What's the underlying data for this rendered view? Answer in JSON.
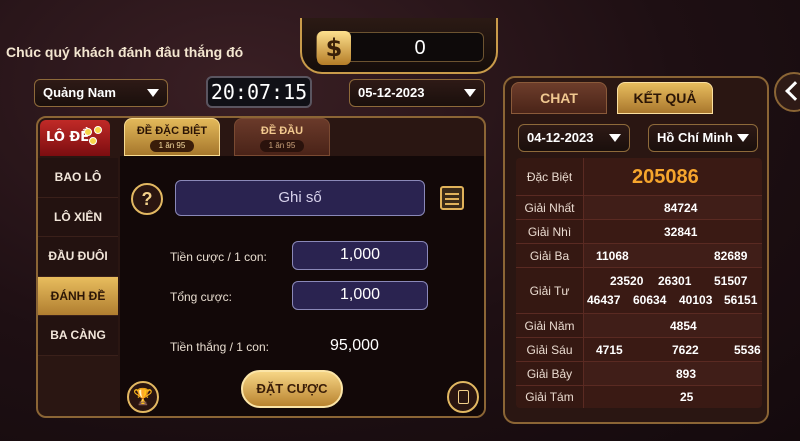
{
  "header": {
    "greeting": "Chúc quý khách đánh đâu thắng đó",
    "balance": "0",
    "currency_icon": "$",
    "province_select": "Quảng Nam",
    "clock": "20:07:15",
    "date_select": "05-12-2023"
  },
  "game": {
    "logo_text": "LÔ ĐỀ",
    "tabs": [
      {
        "label": "ĐỀ ĐẶC BIỆT",
        "count": "1 ăn 95",
        "active": true
      },
      {
        "label": "ĐỀ ĐẦU",
        "count": "1 ăn 95",
        "active": false
      }
    ],
    "side_nav": [
      "BAO LÔ",
      "LÔ XIÊN",
      "ĐẦU ĐUÔI",
      "ĐÁNH ĐỀ",
      "BA CÀNG"
    ],
    "side_nav_active": 3,
    "help_icon": "?",
    "number_input_placeholder": "Ghi số",
    "bet_per_label": "Tiền cược / 1 con:",
    "bet_per_value": "1,000",
    "total_label": "Tổng cược:",
    "total_value": "1,000",
    "win_label": "Tiền thắng / 1 con:",
    "win_value": "95,000",
    "place_bet_label": "ĐẶT CƯỢC"
  },
  "results": {
    "tabs": [
      "CHAT",
      "KẾT QUẢ"
    ],
    "active_tab": 1,
    "date_select": "04-12-2023",
    "region_select": "Hồ Chí Minh",
    "prizes": [
      {
        "name": "Đặc Biệt",
        "values": [
          "205086"
        ]
      },
      {
        "name": "Giải Nhất",
        "values": [
          "84724"
        ]
      },
      {
        "name": "Giải Nhì",
        "values": [
          "32841"
        ]
      },
      {
        "name": "Giải Ba",
        "values": [
          "11068",
          "82689"
        ]
      },
      {
        "name": "Giải Tư",
        "values": [
          "23520",
          "26301",
          "51507",
          "46437",
          "60634",
          "40103",
          "56151"
        ]
      },
      {
        "name": "Giải Năm",
        "values": [
          "4854"
        ]
      },
      {
        "name": "Giải Sáu",
        "values": [
          "4715",
          "7622",
          "5536"
        ]
      },
      {
        "name": "Giải Bảy",
        "values": [
          "893"
        ]
      },
      {
        "name": "Giải Tám",
        "values": [
          "25"
        ]
      }
    ]
  },
  "colors": {
    "accent_gold": "#e8bd5e",
    "special_prize": "#f6a52d",
    "panel_border": "#8b6535"
  }
}
